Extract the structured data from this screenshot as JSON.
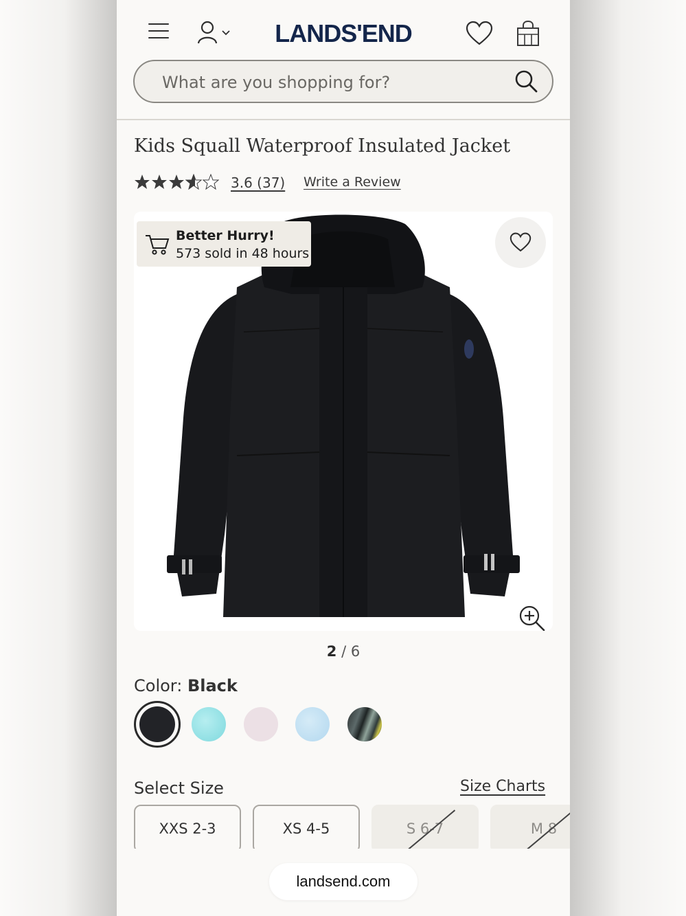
{
  "header": {
    "logo": "LANDS'END",
    "search_placeholder": "What are you shopping for?"
  },
  "product": {
    "title": "Kids Squall Waterproof Insulated Jacket",
    "rating_value": 3.6,
    "rating_text": "3.6 (37)",
    "write_review": "Write a Review",
    "badge_title": "Better Hurry!",
    "badge_subtitle": "573 sold in 48 hours",
    "pager_current": "2",
    "pager_rest": " / 6"
  },
  "color": {
    "label": "Color: ",
    "selected_name": "Black",
    "swatches": [
      {
        "name": "black",
        "hex": "#222327",
        "selected": true
      },
      {
        "name": "aqua",
        "hex": "#8edfe3",
        "selected": false
      },
      {
        "name": "pink",
        "hex": "#ecdde3",
        "selected": false
      },
      {
        "name": "light-blue",
        "hex": "#b9dcf2",
        "selected": false
      },
      {
        "name": "pattern",
        "hex": "#3c4a4a",
        "selected": false
      }
    ]
  },
  "size": {
    "label": "Select Size",
    "charts_link": "Size Charts",
    "options": [
      {
        "label": "XXS 2-3",
        "available": true
      },
      {
        "label": "XS 4-5",
        "available": true
      },
      {
        "label": "S 6-7",
        "available": false
      },
      {
        "label": "M 8",
        "available": false
      }
    ]
  },
  "browser": {
    "url": "landsend.com"
  },
  "icons": [
    "menu-icon",
    "account-icon",
    "chevron-down-icon",
    "heart-icon",
    "bag-icon",
    "search-icon",
    "star-icon",
    "cart-icon",
    "zoom-in-icon"
  ],
  "colors": {
    "logo_navy": "#14264b",
    "star": "#3b3b3b",
    "badge_bg": "#efece6"
  }
}
